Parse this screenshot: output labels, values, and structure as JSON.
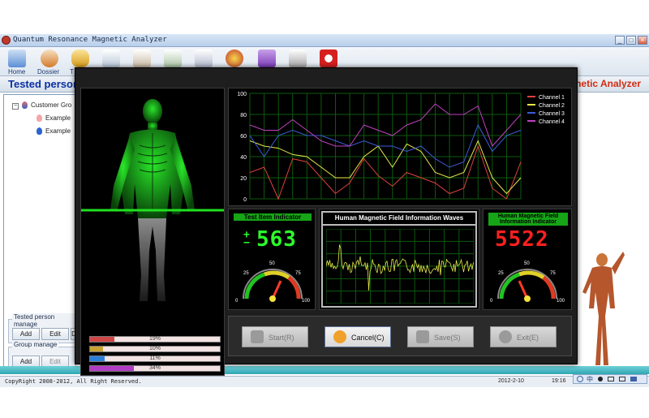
{
  "window": {
    "title": "Quantum Resonance Magnetic Analyzer"
  },
  "toolbar": {
    "items": [
      "Home",
      "Dossier",
      "T"
    ]
  },
  "header": {
    "left_title": "Tested person",
    "right_title": "Magnetic Analyzer"
  },
  "tree": {
    "root": "Customer Gro",
    "items": [
      "Example",
      "Example"
    ]
  },
  "tested_person_manage": {
    "label": "Tested person manage",
    "buttons": [
      "Add",
      "Edit",
      "D"
    ]
  },
  "group_manage": {
    "label": "Group manage",
    "buttons": [
      "Add",
      "Edit"
    ]
  },
  "statusbar": {
    "copyright": "CopyRight 2008-2012, All Right Reserved.",
    "date": "2012-2-10",
    "time": "19:16"
  },
  "tray": {
    "lang": "中"
  },
  "modal": {
    "test_indicator_label": "Test Item Indicator",
    "test_indicator_value": "563",
    "test_indicator_sign_plus": "+",
    "test_indicator_sign_minus": "−",
    "waves_label": "Human Magnetic Field Information Waves",
    "field_indicator_label": "Human Magnetic Field Information Indicator",
    "field_indicator_value": "5522",
    "gauge_left_ticks": [
      "0",
      "25",
      "50",
      "75",
      "100"
    ],
    "gauge_right_ticks": [
      "0",
      "25",
      "50",
      "75",
      "100"
    ],
    "progress": [
      {
        "label": "19%",
        "value": 19,
        "color": "#d04646"
      },
      {
        "label": "10%",
        "value": 10,
        "color": "#c8a232"
      },
      {
        "label": "11%",
        "value": 11,
        "color": "#2b7fd9"
      },
      {
        "label": "34%",
        "value": 34,
        "color": "#b23bc4"
      }
    ],
    "buttons": {
      "start": "Start(R)",
      "cancel": "Cancel(C)",
      "save": "Save(S)",
      "exit": "Exit(E)"
    }
  },
  "chart_data": {
    "type": "line",
    "x": [
      1,
      2,
      3,
      4,
      5,
      6,
      7,
      8,
      9,
      10,
      11,
      12,
      13,
      14,
      15,
      16,
      17,
      18,
      19,
      20
    ],
    "ylim": [
      0,
      100
    ],
    "yticks": [
      "0",
      "20",
      "40",
      "60",
      "80",
      "100"
    ],
    "legend_position": "top-right",
    "series": [
      {
        "name": "Channel 1",
        "color": "#e04040",
        "values": [
          25,
          30,
          0,
          38,
          35,
          20,
          5,
          15,
          38,
          22,
          12,
          25,
          20,
          15,
          5,
          10,
          50,
          10,
          0,
          35
        ]
      },
      {
        "name": "Channel 2",
        "color": "#e8e84a",
        "values": [
          55,
          50,
          48,
          42,
          40,
          30,
          20,
          20,
          40,
          50,
          30,
          52,
          45,
          25,
          20,
          25,
          55,
          20,
          5,
          20
        ]
      },
      {
        "name": "Channel 3",
        "color": "#3d5bd8",
        "values": [
          60,
          40,
          60,
          65,
          60,
          60,
          55,
          50,
          55,
          50,
          50,
          45,
          50,
          38,
          30,
          35,
          70,
          45,
          60,
          65
        ]
      },
      {
        "name": "Channel 4",
        "color": "#c040c0",
        "values": [
          70,
          65,
          65,
          75,
          65,
          55,
          50,
          50,
          70,
          65,
          60,
          70,
          75,
          90,
          80,
          80,
          88,
          50,
          65,
          80
        ]
      }
    ]
  }
}
